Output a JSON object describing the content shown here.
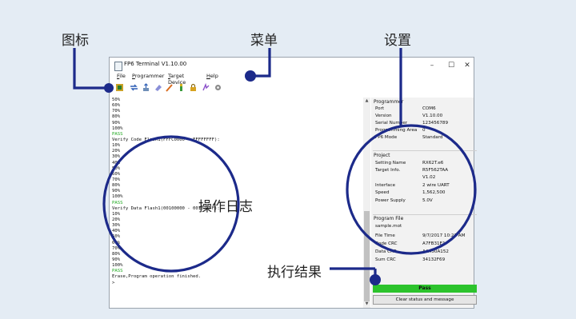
{
  "callouts": {
    "icons": "图标",
    "menu": "菜单",
    "settings": "设置",
    "log": "操作日志",
    "result": "执行结果"
  },
  "window": {
    "title": "FP6 Terminal V1.10.00",
    "controls": [
      "–",
      "☐",
      "✕"
    ]
  },
  "menu": [
    "File",
    "Programmer",
    "Target Device",
    "Help"
  ],
  "toolbar_icons": [
    "connect-icon",
    "transfer-icon",
    "upload-icon",
    "erase-icon",
    "write-icon",
    "verify-icon",
    "lock-icon",
    "program-icon",
    "settings-icon"
  ],
  "terminal": {
    "lines": [
      {
        "t": "50%"
      },
      {
        "t": "60%"
      },
      {
        "t": "70%"
      },
      {
        "t": "80%"
      },
      {
        "t": "90%"
      },
      {
        "t": "100%"
      },
      {
        "t": "PASS",
        "pass": true
      },
      {
        "t": "Verify Code Flash1(FFFC0000 - FFFFFFFF):"
      },
      {
        "t": "10%"
      },
      {
        "t": "20%"
      },
      {
        "t": "30%"
      },
      {
        "t": "40%"
      },
      {
        "t": "50%"
      },
      {
        "t": "60%"
      },
      {
        "t": "70%"
      },
      {
        "t": "80%"
      },
      {
        "t": "90%"
      },
      {
        "t": "100%"
      },
      {
        "t": "PASS",
        "pass": true
      },
      {
        "t": "Verify Data Flash1(00100000 - 00107FFF):"
      },
      {
        "t": "10%"
      },
      {
        "t": "20%"
      },
      {
        "t": "30%"
      },
      {
        "t": "40%"
      },
      {
        "t": "50%"
      },
      {
        "t": "60%"
      },
      {
        "t": "70%"
      },
      {
        "t": "80%"
      },
      {
        "t": "90%"
      },
      {
        "t": "100%"
      },
      {
        "t": "PASS",
        "pass": true
      },
      {
        "t": "Erase,Program operation finished."
      },
      {
        "t": ">"
      }
    ]
  },
  "panel": {
    "programmer": {
      "title": "Programmer",
      "rows": [
        {
          "k": "Port",
          "v": "COM6"
        },
        {
          "k": "Version",
          "v": "V1.10.00"
        },
        {
          "k": "Serial Number",
          "v": "123456789"
        },
        {
          "k": "Programming Area",
          "v": "0"
        },
        {
          "k": "FP6 Mode",
          "v": "Standard"
        }
      ]
    },
    "project": {
      "title": "Project",
      "rows": [
        {
          "k": "Setting Name",
          "v": "RX62T.e6"
        },
        {
          "k": "Target Info.",
          "v": "R5F562TAA"
        },
        {
          "k": "",
          "v": "V1.02"
        },
        {
          "k": "Interface",
          "v": "2 wire UART"
        },
        {
          "k": "Speed",
          "v": "1,562,500"
        },
        {
          "k": "Power Supply",
          "v": "5.0V"
        }
      ]
    },
    "program_file": {
      "title": "Program File",
      "filename": "sample.mot",
      "rows": [
        {
          "k": "File Time",
          "v": "9/7/2017 10:23 AM"
        },
        {
          "k": "Code CRC",
          "v": "A7FB31E1"
        },
        {
          "k": "Data CRC",
          "v": "AA450A152"
        },
        {
          "k": "Sum CRC",
          "v": "34132F69"
        }
      ]
    },
    "status": "Pass",
    "clear_button": "Clear status and message"
  },
  "colors": {
    "accent": "#1c2a8a",
    "pass": "#2cc32c",
    "pass_text": "#22aa22"
  }
}
